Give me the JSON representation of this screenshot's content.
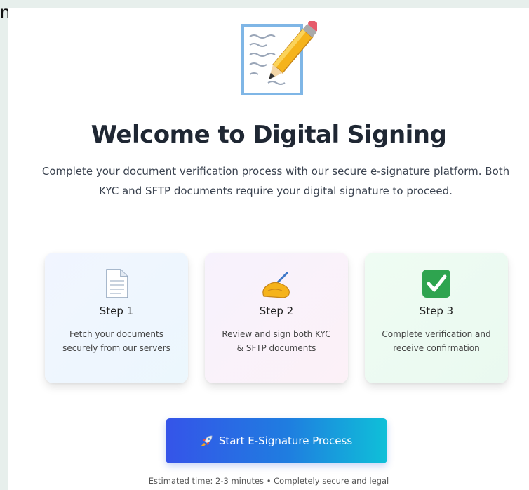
{
  "corner_text": "n",
  "title": "Welcome to Digital Signing",
  "subtitle": "Complete your document verification process with our secure e-signature platform. Both KYC and SFTP documents require your digital signature to proceed.",
  "steps": [
    {
      "icon": "document-icon",
      "title": "Step 1",
      "description": "Fetch your documents securely from our servers"
    },
    {
      "icon": "writing-hand-icon",
      "title": "Step 2",
      "description": "Review and sign both KYC & SFTP documents"
    },
    {
      "icon": "check-mark-icon",
      "title": "Step 3",
      "description": "Complete verification and receive confirmation"
    }
  ],
  "start_button": {
    "icon": "rocket-icon",
    "label": "Start E-Signature Process"
  },
  "footnote": "Estimated time: 2-3 minutes • Completely secure and legal",
  "colors": {
    "background": "#e7efec",
    "title": "#1f2733",
    "button_gradient_start": "#3554e9",
    "button_gradient_end": "#0fc0d8",
    "check_green": "#2ea44f",
    "pencil_yellow": "#f5b31b"
  }
}
